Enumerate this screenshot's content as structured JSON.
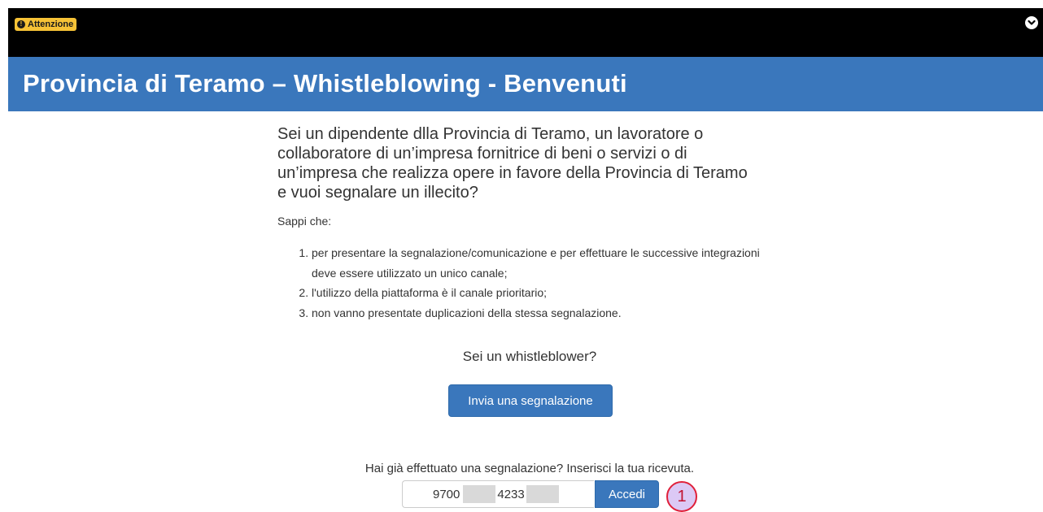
{
  "alert": {
    "badge_icon": "!",
    "badge_label": "Attenzione",
    "toggle_icon": "chevron-down-icon"
  },
  "header": {
    "title": "Provincia di Teramo – Whistleblowing - Benvenuti"
  },
  "intro": {
    "lead": "Sei un dipendente dlla Provincia di Teramo, un lavoratore o collaboratore di un’impresa fornitrice di beni o servizi o di un’impresa che realizza opere in favore della Provincia di Teramo e vuoi segnalare un illecito?",
    "sappi": "Sappi che:",
    "items": [
      "per presentare la segnalazione/comunicazione e per effettuare le successive integrazioni deve essere utilizzato un unico canale;",
      "l'utilizzo della piattaforma è il canale prioritario;",
      "non vanno presentate duplicazioni della stessa segnalazione."
    ]
  },
  "whistleblower": {
    "question": "Sei un whistleblower?",
    "submit_label": "Invia una segnalazione"
  },
  "receipt": {
    "question": "Hai già effettuato una segnalazione? Inserisci la tua ricevuta.",
    "value_part1": "9700",
    "value_part2": "4233",
    "login_label": "Accedi"
  },
  "annotation": {
    "marker": "1"
  },
  "colors": {
    "header_bg": "#3a77bc",
    "alert_bg": "#000000",
    "badge_bg": "#f6c236",
    "marker_border": "#e0203a"
  }
}
